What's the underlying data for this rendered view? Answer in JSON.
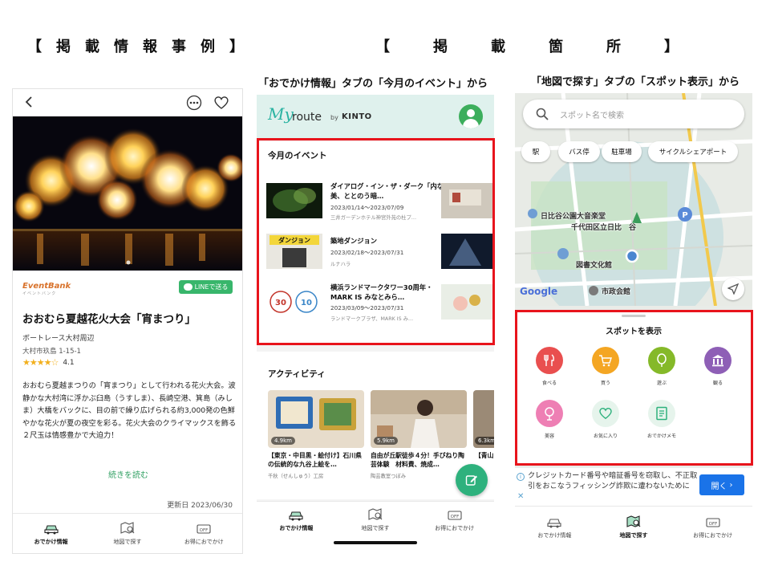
{
  "left_heading": "【　掲　載　情　報　事　例　】",
  "right_heading": "【　　　掲　　　載　　　箇　　　所　　　】",
  "phone1": {
    "eventbank_logo": "EventBank",
    "eventbank_logo_sub": "イベントバンク",
    "line_button": "LINEで送る",
    "event_title": "おおむら夏越花火大会「宵まつり」",
    "venue": "ボートレース大村周辺",
    "address": "大村市玖島 1-15-1",
    "rating": "4.1",
    "description": "おおむら夏越まつりの「宵まつり」として行われる花火大会。波静かな大村湾に浮かぶ臼島（うすしま）、長崎空港、箕島（みしま）大橋をバックに、目の前で繰り広げられる約3,000発の色鮮やかな花火が夏の夜空を彩る。花火大会のクライマックスを飾る２尺玉は情感豊かで大迫力！",
    "read_more": "続きを読む",
    "updated": "更新日 2023/06/30"
  },
  "nav": {
    "outing": "おでかけ情報",
    "map_search": "地図で探す",
    "deals": "お得におでかけ"
  },
  "phone2": {
    "caption": "「おでかけ情報」タブの「今月のイベント」から",
    "logo_my": "My",
    "logo_route": "route",
    "logo_by": "by",
    "logo_kinto": "KINTO",
    "events_title": "今月のイベント",
    "events": [
      {
        "title": "ダイアログ・イン・ザ・ダーク「内なる美、ととのう暗…",
        "date": "2023/01/14～2023/07/09",
        "place": "三井ガーデンホテル神宮外苑の杜プ…"
      },
      {
        "title": "築地ダンジョン",
        "date": "2023/02/18～2023/07/31",
        "place": "ルナハラ"
      },
      {
        "title": "横浜ランドマークタワー30周年・MARK IS みなとみら…",
        "date": "2023/03/09～2023/07/31",
        "place": "ランドマークプラザ、MARK IS み…"
      }
    ],
    "activity_title": "アクティビティ",
    "activities": [
      {
        "distance": "4.9km",
        "title": "【東京・中目黒・絵付け】石川県の伝統的な九谷上絵を…",
        "shop": "千秋（せんしゅう）工房"
      },
      {
        "distance": "5.9km",
        "title": "自由が丘駅徒歩４分！手びねり陶芸体験　材料費、焼成…",
        "shop": "陶芸教室つぼみ"
      },
      {
        "distance": "6.3km",
        "title": "【青山…",
        "shop": ""
      }
    ]
  },
  "phone3": {
    "caption": "「地図で探す」タブの「スポット表示」から",
    "search_placeholder": "スポット名で検索",
    "chips": [
      "駅",
      "バス停",
      "駐車場",
      "サイクルシェアポート"
    ],
    "map_labels": {
      "park": "日比谷公園大音楽堂",
      "library1": "千代田区立日比",
      "library2": "谷",
      "library3": "図書文化館",
      "office": "市政会館",
      "google": "Google"
    },
    "sheet_title": "スポットを表示",
    "spots": [
      {
        "label": "食べる",
        "color": "#e94f4f"
      },
      {
        "label": "買う",
        "color": "#f4a623"
      },
      {
        "label": "遊ぶ",
        "color": "#85b929"
      },
      {
        "label": "観る",
        "color": "#8e5fb6"
      },
      {
        "label": "美容",
        "color": "#ee7fb4"
      },
      {
        "label": "お気に入り",
        "color": "#e6f4ec"
      },
      {
        "label": "おでかけメモ",
        "color": "#e6f4ec"
      }
    ],
    "ad_text": "クレジットカード番号や暗証番号を窃取し、不正取引をおこなうフィッシング詐欺に遭わないために",
    "ad_button": "開く"
  },
  "colors": {
    "highlight": "#e8141c",
    "brand_green": "#2eb17d",
    "line_green": "#38b66b"
  }
}
